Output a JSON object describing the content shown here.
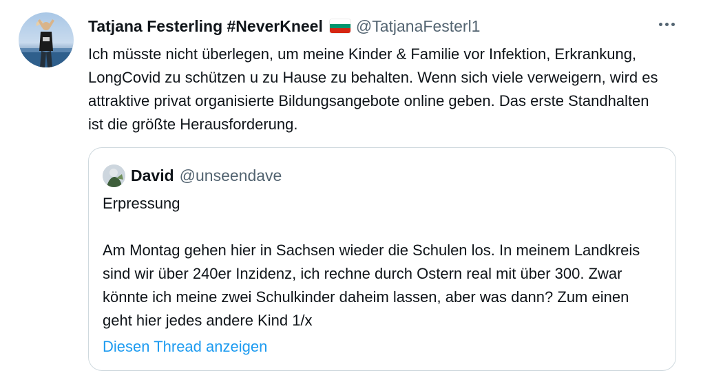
{
  "tweet": {
    "author_name": "Tatjana Festerling #NeverKneel",
    "flag_colors": [
      "#ffffff",
      "#00966e",
      "#d62612"
    ],
    "handle": "@TatjanaFesterl1",
    "text": "Ich müsste nicht überlegen, um meine Kinder & Familie vor Infektion, Erkrankung, LongCovid zu schützen u zu Hause zu behalten. Wenn sich viele verweigern, wird es attraktive privat organisierte Bildungsangebote online geben. Das erste Standhalten ist die größte Herausforderung.",
    "more_icon": "more-horizontal-icon"
  },
  "quoted": {
    "author_name": "David",
    "handle": "@unseendave",
    "text": "Erpressung\n\nAm Montag gehen hier in Sachsen wieder die Schulen los. In meinem Landkreis sind wir über 240er Inzidenz, ich rechne durch Ostern real mit über 300. Zwar könnte ich meine zwei Schulkinder daheim lassen, aber was dann? Zum einen geht hier jedes andere Kind 1/x",
    "show_thread": "Diesen Thread anzeigen"
  },
  "colors": {
    "link": "#1d9bf0",
    "secondary_text": "#536471",
    "border": "#cfd9de"
  }
}
